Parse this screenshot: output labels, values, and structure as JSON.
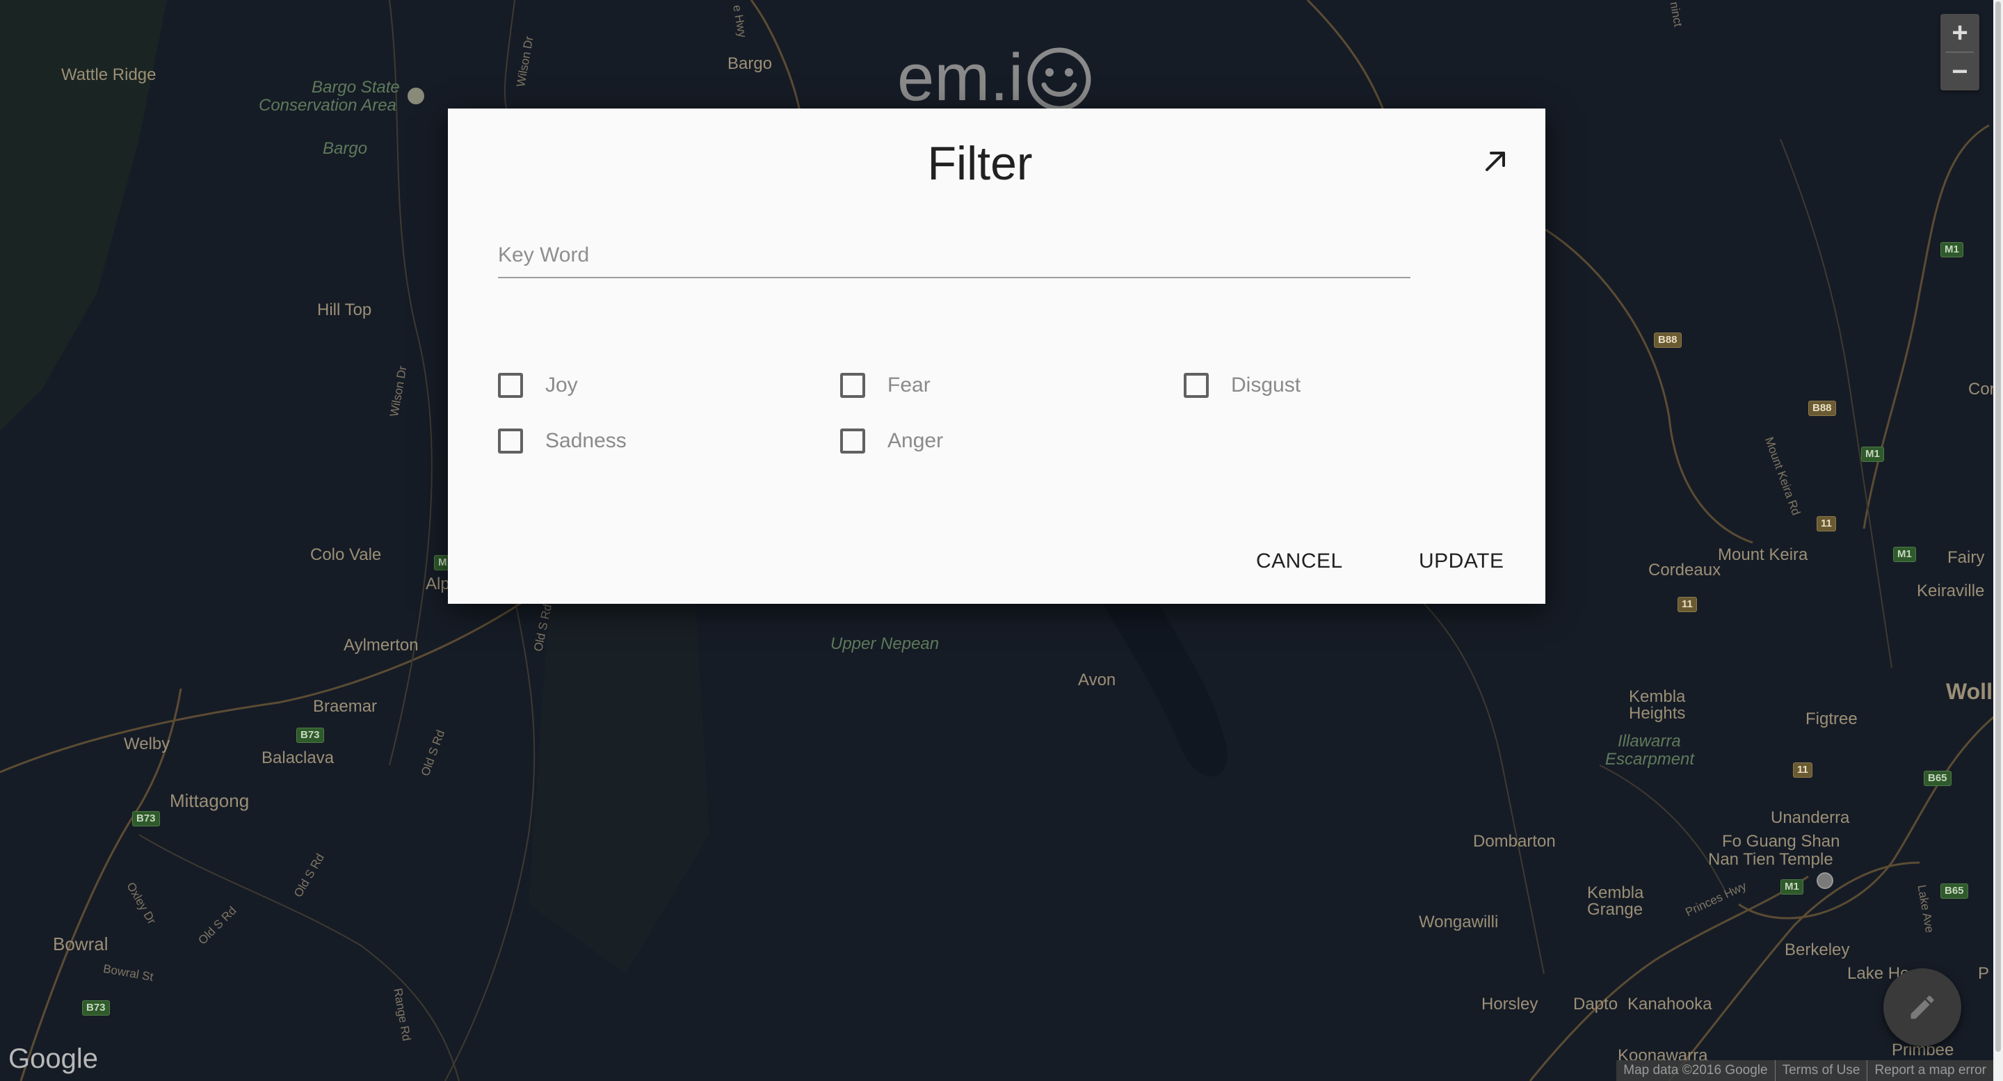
{
  "app": {
    "logo_text": "em.i"
  },
  "map": {
    "places": [
      "Wattle Ridge",
      "Bargo State",
      "Conservation Area",
      "Bargo",
      "Bargo",
      "Hill Top",
      "Colo Vale",
      "Aylmerton",
      "Braemar",
      "Welby",
      "Balaclava",
      "Mittagong",
      "Bowral",
      "Upper Nepean",
      "Avon",
      "Cordeaux",
      "Mount Keira",
      "Fairy",
      "Keiraville",
      "Kembla",
      "Heights",
      "Illawarra",
      "Escarpment",
      "Figtree",
      "Woll",
      "Cor",
      "Unanderra",
      "Fo Guang Shan",
      "Nan Tien Temple",
      "Dombarton",
      "Kembla",
      "Grange",
      "Wongawilli",
      "Berkeley",
      "Lake He",
      "Horsley",
      "Dapto",
      "Kanahooka",
      "Koonawarra",
      "Primbee",
      "Alp",
      "P"
    ],
    "roads": [
      "Wilson Dr",
      "Wilson Dr",
      "e Hwy",
      "Old S Rd",
      "Old S Rd",
      "Old S Rd",
      "Old S Rd",
      "Oxley Dr",
      "Bowral St",
      "Range Rd",
      "Mount Keira Rd",
      "Princes Hwy",
      "Lake Ave",
      "ninct"
    ],
    "shields": [
      "B88",
      "B88",
      "M1",
      "M1",
      "M1",
      "M1",
      "11",
      "11",
      "11",
      "B73",
      "B73",
      "B73",
      "B65",
      "B65",
      "M"
    ],
    "google_logo": "Google",
    "attribution": [
      "Map data ©2016 Google",
      "Terms of Use",
      "Report a map error"
    ],
    "zoom_in": "+",
    "zoom_out": "−"
  },
  "dialog": {
    "title": "Filter",
    "keyword_placeholder": "Key Word",
    "keyword_value": "",
    "emotions": [
      {
        "label": "Joy",
        "checked": false
      },
      {
        "label": "Fear",
        "checked": false
      },
      {
        "label": "Disgust",
        "checked": false
      },
      {
        "label": "Sadness",
        "checked": false
      },
      {
        "label": "Anger",
        "checked": false
      }
    ],
    "cancel_label": "CANCEL",
    "update_label": "UPDATE"
  },
  "colors": {
    "map_background": "#161c26",
    "dialog_background": "#fafafa",
    "road": "#6b5a3a",
    "water": "#0f1520"
  }
}
